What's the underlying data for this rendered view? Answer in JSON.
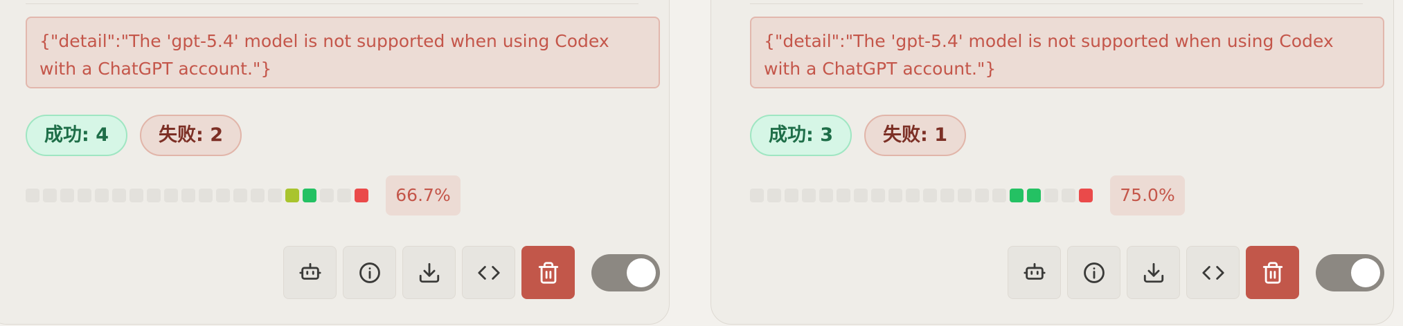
{
  "cards": [
    {
      "error": "{\"detail\":\"The 'gpt-5.4' model is not supported when using Codex with a ChatGPT account.\"}",
      "success_label": "成功: 4",
      "fail_label": "失败: 2",
      "success_rate": "66.7%",
      "history": [
        "empty",
        "empty",
        "empty",
        "empty",
        "empty",
        "empty",
        "empty",
        "empty",
        "empty",
        "empty",
        "empty",
        "empty",
        "empty",
        "empty",
        "empty",
        "lime",
        "green",
        "empty",
        "empty",
        "red"
      ],
      "enabled": true
    },
    {
      "error": "{\"detail\":\"The 'gpt-5.4' model is not supported when using Codex with a ChatGPT account.\"}",
      "success_label": "成功: 3",
      "fail_label": "失败: 1",
      "success_rate": "75.0%",
      "history": [
        "empty",
        "empty",
        "empty",
        "empty",
        "empty",
        "empty",
        "empty",
        "empty",
        "empty",
        "empty",
        "empty",
        "empty",
        "empty",
        "empty",
        "empty",
        "green",
        "green",
        "empty",
        "empty",
        "red"
      ],
      "enabled": true
    }
  ],
  "icons": {
    "model": "robot-icon",
    "info": "info-icon",
    "download": "download-icon",
    "code": "code-icon",
    "delete": "trash-icon"
  },
  "colors": {
    "success": "#24c163",
    "partial": "#a9c42e",
    "failure": "#ea4a4a",
    "delete_button": "#c2574a",
    "toggle_on": "#8c8882"
  }
}
